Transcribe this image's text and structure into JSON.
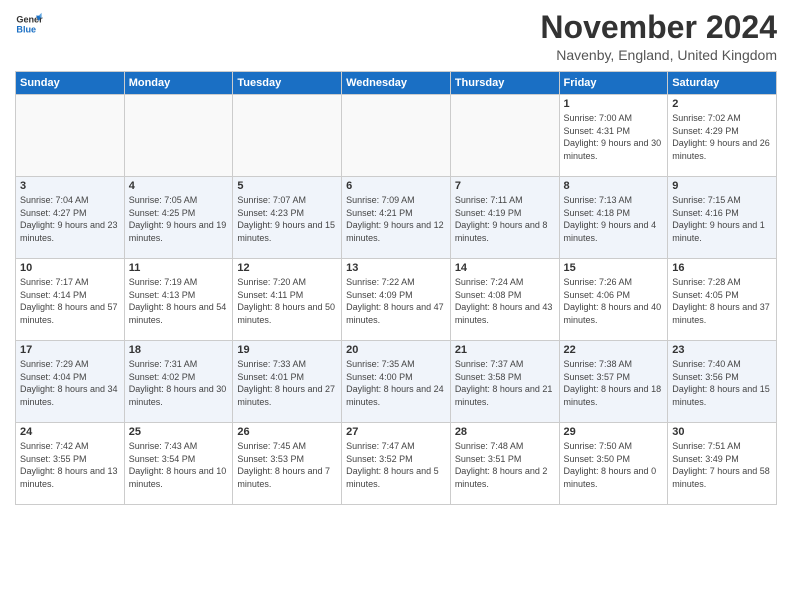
{
  "logo": {
    "line1": "General",
    "line2": "Blue"
  },
  "title": "November 2024",
  "location": "Navenby, England, United Kingdom",
  "headers": [
    "Sunday",
    "Monday",
    "Tuesday",
    "Wednesday",
    "Thursday",
    "Friday",
    "Saturday"
  ],
  "weeks": [
    [
      {
        "day": "",
        "info": ""
      },
      {
        "day": "",
        "info": ""
      },
      {
        "day": "",
        "info": ""
      },
      {
        "day": "",
        "info": ""
      },
      {
        "day": "",
        "info": ""
      },
      {
        "day": "1",
        "info": "Sunrise: 7:00 AM\nSunset: 4:31 PM\nDaylight: 9 hours\nand 30 minutes."
      },
      {
        "day": "2",
        "info": "Sunrise: 7:02 AM\nSunset: 4:29 PM\nDaylight: 9 hours\nand 26 minutes."
      }
    ],
    [
      {
        "day": "3",
        "info": "Sunrise: 7:04 AM\nSunset: 4:27 PM\nDaylight: 9 hours\nand 23 minutes."
      },
      {
        "day": "4",
        "info": "Sunrise: 7:05 AM\nSunset: 4:25 PM\nDaylight: 9 hours\nand 19 minutes."
      },
      {
        "day": "5",
        "info": "Sunrise: 7:07 AM\nSunset: 4:23 PM\nDaylight: 9 hours\nand 15 minutes."
      },
      {
        "day": "6",
        "info": "Sunrise: 7:09 AM\nSunset: 4:21 PM\nDaylight: 9 hours\nand 12 minutes."
      },
      {
        "day": "7",
        "info": "Sunrise: 7:11 AM\nSunset: 4:19 PM\nDaylight: 9 hours\nand 8 minutes."
      },
      {
        "day": "8",
        "info": "Sunrise: 7:13 AM\nSunset: 4:18 PM\nDaylight: 9 hours\nand 4 minutes."
      },
      {
        "day": "9",
        "info": "Sunrise: 7:15 AM\nSunset: 4:16 PM\nDaylight: 9 hours\nand 1 minute."
      }
    ],
    [
      {
        "day": "10",
        "info": "Sunrise: 7:17 AM\nSunset: 4:14 PM\nDaylight: 8 hours\nand 57 minutes."
      },
      {
        "day": "11",
        "info": "Sunrise: 7:19 AM\nSunset: 4:13 PM\nDaylight: 8 hours\nand 54 minutes."
      },
      {
        "day": "12",
        "info": "Sunrise: 7:20 AM\nSunset: 4:11 PM\nDaylight: 8 hours\nand 50 minutes."
      },
      {
        "day": "13",
        "info": "Sunrise: 7:22 AM\nSunset: 4:09 PM\nDaylight: 8 hours\nand 47 minutes."
      },
      {
        "day": "14",
        "info": "Sunrise: 7:24 AM\nSunset: 4:08 PM\nDaylight: 8 hours\nand 43 minutes."
      },
      {
        "day": "15",
        "info": "Sunrise: 7:26 AM\nSunset: 4:06 PM\nDaylight: 8 hours\nand 40 minutes."
      },
      {
        "day": "16",
        "info": "Sunrise: 7:28 AM\nSunset: 4:05 PM\nDaylight: 8 hours\nand 37 minutes."
      }
    ],
    [
      {
        "day": "17",
        "info": "Sunrise: 7:29 AM\nSunset: 4:04 PM\nDaylight: 8 hours\nand 34 minutes."
      },
      {
        "day": "18",
        "info": "Sunrise: 7:31 AM\nSunset: 4:02 PM\nDaylight: 8 hours\nand 30 minutes."
      },
      {
        "day": "19",
        "info": "Sunrise: 7:33 AM\nSunset: 4:01 PM\nDaylight: 8 hours\nand 27 minutes."
      },
      {
        "day": "20",
        "info": "Sunrise: 7:35 AM\nSunset: 4:00 PM\nDaylight: 8 hours\nand 24 minutes."
      },
      {
        "day": "21",
        "info": "Sunrise: 7:37 AM\nSunset: 3:58 PM\nDaylight: 8 hours\nand 21 minutes."
      },
      {
        "day": "22",
        "info": "Sunrise: 7:38 AM\nSunset: 3:57 PM\nDaylight: 8 hours\nand 18 minutes."
      },
      {
        "day": "23",
        "info": "Sunrise: 7:40 AM\nSunset: 3:56 PM\nDaylight: 8 hours\nand 15 minutes."
      }
    ],
    [
      {
        "day": "24",
        "info": "Sunrise: 7:42 AM\nSunset: 3:55 PM\nDaylight: 8 hours\nand 13 minutes."
      },
      {
        "day": "25",
        "info": "Sunrise: 7:43 AM\nSunset: 3:54 PM\nDaylight: 8 hours\nand 10 minutes."
      },
      {
        "day": "26",
        "info": "Sunrise: 7:45 AM\nSunset: 3:53 PM\nDaylight: 8 hours\nand 7 minutes."
      },
      {
        "day": "27",
        "info": "Sunrise: 7:47 AM\nSunset: 3:52 PM\nDaylight: 8 hours\nand 5 minutes."
      },
      {
        "day": "28",
        "info": "Sunrise: 7:48 AM\nSunset: 3:51 PM\nDaylight: 8 hours\nand 2 minutes."
      },
      {
        "day": "29",
        "info": "Sunrise: 7:50 AM\nSunset: 3:50 PM\nDaylight: 8 hours\nand 0 minutes."
      },
      {
        "day": "30",
        "info": "Sunrise: 7:51 AM\nSunset: 3:49 PM\nDaylight: 7 hours\nand 58 minutes."
      }
    ]
  ]
}
